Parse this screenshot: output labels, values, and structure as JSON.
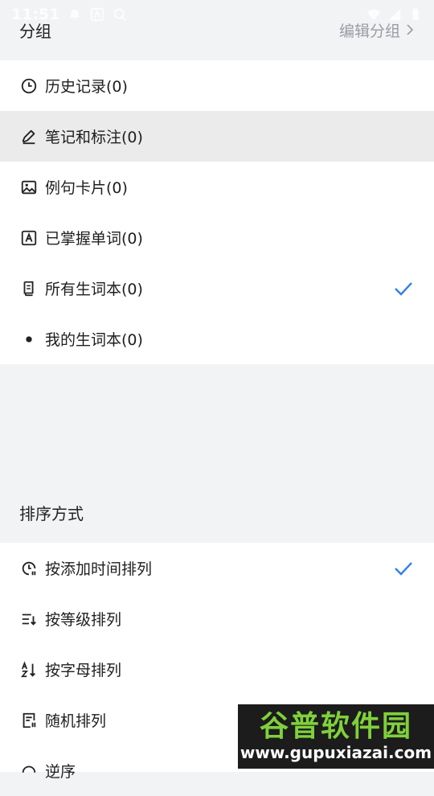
{
  "status_bar": {
    "time": "11:51"
  },
  "groups": {
    "title": "分组",
    "edit_label": "编辑分组",
    "items": [
      {
        "label": "历史记录(0)",
        "icon": "clock-icon",
        "highlighted": false,
        "checked": false
      },
      {
        "label": "笔记和标注(0)",
        "icon": "pen-icon",
        "highlighted": true,
        "checked": false
      },
      {
        "label": "例句卡片(0)",
        "icon": "image-icon",
        "highlighted": false,
        "checked": false
      },
      {
        "label": "已掌握单词(0)",
        "icon": "letter-a-icon",
        "highlighted": false,
        "checked": false
      },
      {
        "label": "所有生词本(0)",
        "icon": "book-icon",
        "highlighted": false,
        "checked": true
      },
      {
        "label": "我的生词本(0)",
        "icon": "dot-icon",
        "highlighted": false,
        "checked": false
      }
    ]
  },
  "sort": {
    "title": "排序方式",
    "items": [
      {
        "label": "按添加时间排列",
        "icon": "clock-sort-icon",
        "checked": true
      },
      {
        "label": "按等级排列",
        "icon": "level-sort-icon",
        "checked": false
      },
      {
        "label": "按字母排列",
        "icon": "alpha-sort-icon",
        "checked": false
      },
      {
        "label": "随机排列",
        "icon": "shuffle-icon",
        "checked": false
      },
      {
        "label": "逆序",
        "icon": "reverse-icon",
        "checked": false
      }
    ]
  },
  "watermark": {
    "name": "谷普软件园",
    "url": "www.gupuxiazai.com"
  },
  "colors": {
    "accent": "#2f80ed",
    "highlight_bg": "#ebebeb",
    "page_bg": "#f2f3f5",
    "muted_text": "#9a9ca3"
  }
}
